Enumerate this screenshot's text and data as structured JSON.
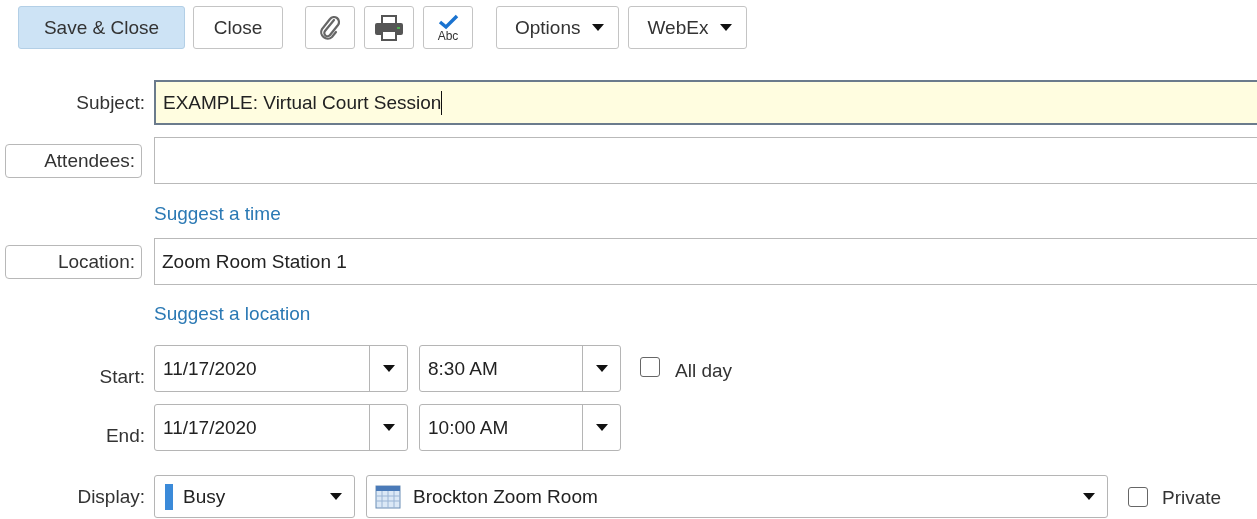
{
  "toolbar": {
    "buttons": [
      {
        "kind": "primary",
        "label": "Save & Close"
      },
      {
        "kind": "text",
        "label": "Close"
      },
      {
        "kind": "attach"
      },
      {
        "kind": "print"
      },
      {
        "kind": "spell",
        "label": "Abc"
      },
      {
        "kind": "menu",
        "label": "Options"
      },
      {
        "kind": "menu",
        "label": "WebEx"
      }
    ]
  },
  "subject": {
    "label": "Subject:",
    "value": "EXAMPLE: Virtual Court Session"
  },
  "attendees": {
    "label": "Attendees:"
  },
  "suggest_time": "Suggest a time",
  "location": {
    "label": "Location:",
    "value": "Zoom Room Station 1"
  },
  "suggest_location": "Suggest a location",
  "start": {
    "label": "Start:",
    "date": "11/17/2020",
    "time": "8:30 AM"
  },
  "all_day": {
    "label": "All day",
    "checked": false
  },
  "end": {
    "label": "End:",
    "date": "11/17/2020",
    "time": "10:00 AM"
  },
  "display": {
    "label": "Display:",
    "status": "Busy",
    "calendar": "Brockton Zoom Room"
  },
  "private": {
    "label": "Private",
    "checked": false
  }
}
